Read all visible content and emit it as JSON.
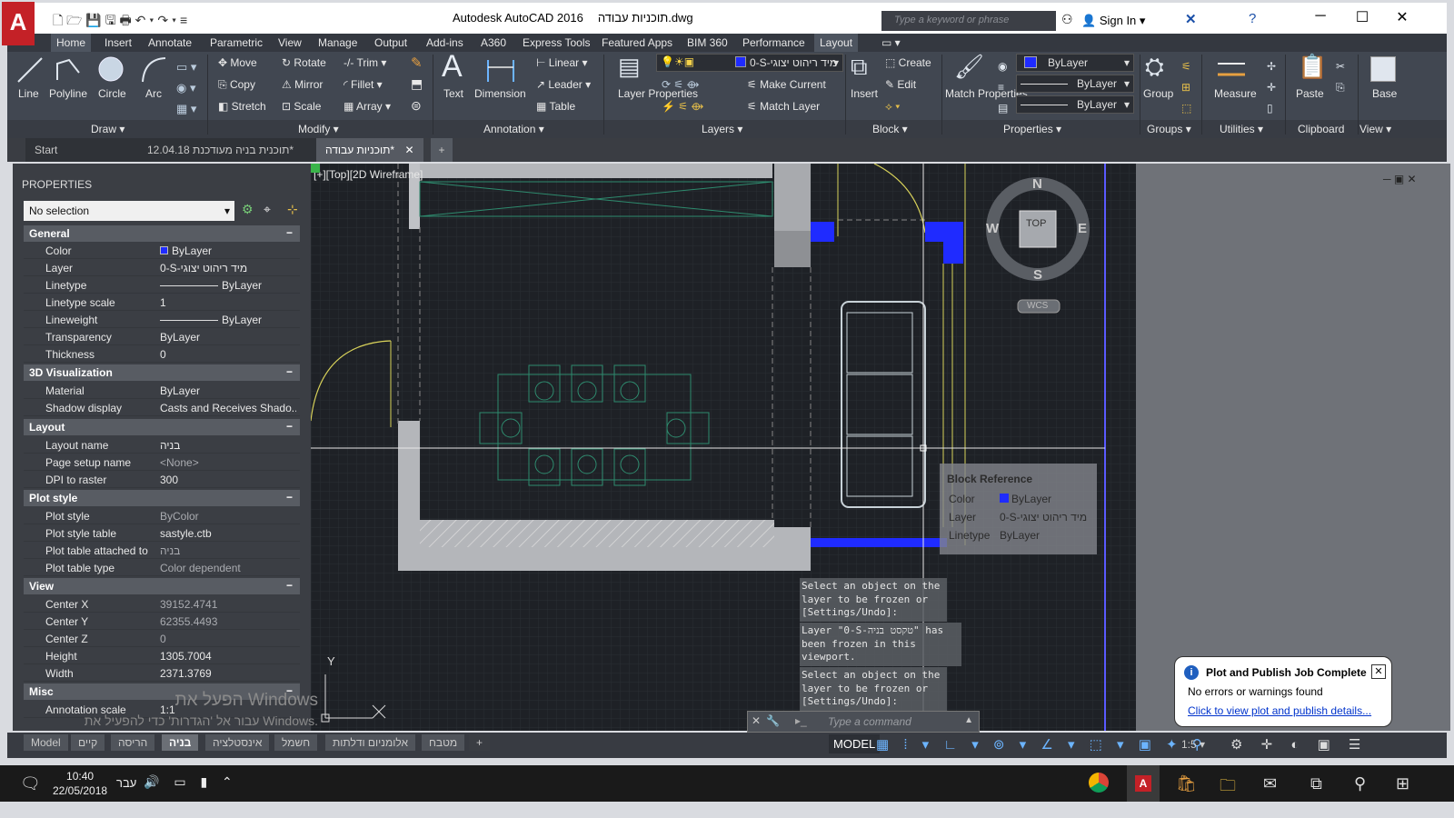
{
  "app": {
    "title": "Autodesk AutoCAD 2016",
    "file": "תוכניות עבודה.dwg",
    "search_placeholder": "Type a keyword or phrase",
    "signin": "Sign In"
  },
  "menu_tabs": [
    "Home",
    "Insert",
    "Annotate",
    "Parametric",
    "View",
    "Manage",
    "Output",
    "Add-ins",
    "A360",
    "Express Tools",
    "Featured Apps",
    "BIM 360",
    "Performance",
    "Layout"
  ],
  "ribbon": {
    "draw": {
      "line": "Line",
      "polyline": "Polyline",
      "circle": "Circle",
      "arc": "Arc",
      "label": "Draw"
    },
    "modify": {
      "move": "Move",
      "rotate": "Rotate",
      "trim": "Trim",
      "copy": "Copy",
      "mirror": "Mirror",
      "fillet": "Fillet",
      "stretch": "Stretch",
      "scale": "Scale",
      "array": "Array",
      "label": "Modify"
    },
    "annotation": {
      "text": "Text",
      "dimension": "Dimension",
      "linear": "Linear",
      "leader": "Leader",
      "table": "Table",
      "label": "Annotation"
    },
    "layers": {
      "layer_properties": "Layer Properties",
      "current_layer": "0-S-מיד ריהוט יצוגי",
      "make_current": "Make Current",
      "match_layer": "Match Layer",
      "label": "Layers"
    },
    "block": {
      "insert": "Insert",
      "create": "Create",
      "edit": "Edit",
      "label": "Block"
    },
    "properties": {
      "match": "Match Properties",
      "color": "ByLayer",
      "linetype": "ByLayer",
      "lineweight": "ByLayer",
      "label": "Properties"
    },
    "groups": {
      "group": "Group",
      "label": "Groups"
    },
    "utilities": {
      "measure": "Measure",
      "label": "Utilities"
    },
    "clipboard": {
      "paste": "Paste",
      "label": "Clipboard"
    },
    "view": {
      "base": "Base",
      "label": "View"
    }
  },
  "doc_tabs": [
    {
      "label": "Start"
    },
    {
      "label": "12.04.18 תוכנית בניה מעודכנת*"
    },
    {
      "label": "תוכניות עבודה*"
    }
  ],
  "properties": {
    "title": "PROPERTIES",
    "selection": "No selection",
    "sections": [
      {
        "name": "General",
        "rows": [
          [
            "Color",
            "ByLayer"
          ],
          [
            "Layer",
            "0-S-מיד ריהוט יצוגי"
          ],
          [
            "Linetype",
            "ByLayer"
          ],
          [
            "Linetype scale",
            "1"
          ],
          [
            "Lineweight",
            "ByLayer"
          ],
          [
            "Transparency",
            "ByLayer"
          ],
          [
            "Thickness",
            "0"
          ]
        ]
      },
      {
        "name": "3D Visualization",
        "rows": [
          [
            "Material",
            "ByLayer"
          ],
          [
            "Shadow display",
            "Casts and Receives Shado..."
          ]
        ]
      },
      {
        "name": "Layout",
        "rows": [
          [
            "Layout name",
            "בניה"
          ],
          [
            "Page setup name",
            "<None>"
          ],
          [
            "DPI to raster",
            "300"
          ]
        ]
      },
      {
        "name": "Plot style",
        "rows": [
          [
            "Plot style",
            "ByColor"
          ],
          [
            "Plot style table",
            "sastyle.ctb"
          ],
          [
            "Plot table attached to",
            "בניה"
          ],
          [
            "Plot table type",
            "Color dependent"
          ]
        ]
      },
      {
        "name": "View",
        "rows": [
          [
            "Center X",
            "39152.4741"
          ],
          [
            "Center Y",
            "62355.4493"
          ],
          [
            "Center Z",
            "0"
          ],
          [
            "Height",
            "1305.7004"
          ],
          [
            "Width",
            "2371.3769"
          ]
        ]
      },
      {
        "name": "Misc",
        "rows": [
          [
            "Annotation scale",
            "1:1"
          ]
        ]
      }
    ]
  },
  "canvas": {
    "viewport_label": "[+][Top][2D Wireframe]",
    "viewcube": {
      "n": "N",
      "s": "S",
      "e": "E",
      "w": "W",
      "top": "TOP",
      "wcs": "WCS"
    },
    "ucs": {
      "y": "Y"
    },
    "cmd_history": [
      "Select an object on the layer to be frozen or [Settings/Undo]:",
      "Layer \"0-S-טקסט בניה\" has been frozen in this viewport.",
      "Select an object on the layer to be frozen or [Settings/Undo]:"
    ],
    "cmd_placeholder": "Type a command",
    "tooltip": {
      "title": "Block Reference",
      "color_k": "Color",
      "color_v": "ByLayer",
      "layer_k": "Layer",
      "layer_v": "0-S-מיד ריהוט יצוגי",
      "lt_k": "Linetype",
      "lt_v": "ByLayer"
    }
  },
  "watermark": {
    "line1": "הפעל את Windows",
    "line2": "עבור אל 'הגדרות' כדי להפעיל את Windows."
  },
  "layout_tabs": [
    "Model",
    "קיים",
    "הריסה",
    "בניה",
    "אינסטלציה",
    "חשמל",
    "אלומניום ודלתות",
    "מטבח"
  ],
  "active_layout": "בניה",
  "status": {
    "model": "MODEL",
    "scale": "1:5"
  },
  "notification": {
    "title": "Plot and Publish Job Complete",
    "body": "No errors or warnings found",
    "link": "Click to view plot and publish details..."
  },
  "taskbar": {
    "time": "10:40",
    "date": "22/05/2018",
    "lang": "עבר"
  },
  "colors": {
    "accent": "#c42127",
    "ribbon": "#414751",
    "canvas": "#1e2126",
    "blue": "#1f2bff"
  }
}
